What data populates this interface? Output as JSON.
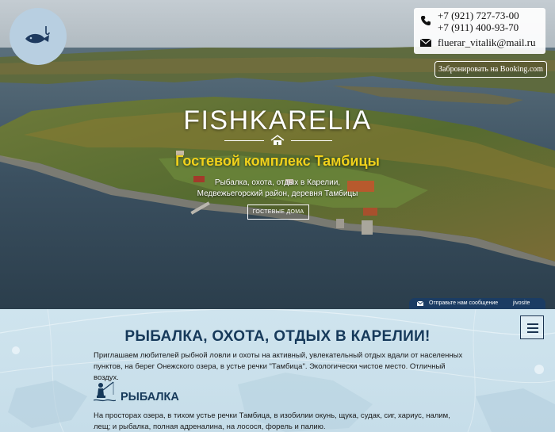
{
  "header": {
    "logo_icon": "fish-hook-icon",
    "phones": [
      "+7 (921) 727-73-00",
      "+7 (911) 400-93-70"
    ],
    "email": "fluerar_vitalik@mail.ru",
    "booking_label": "Забронировать на Booking.com"
  },
  "hero": {
    "brand": "FISHKARELIA",
    "subtitle": "Гостевой комплекс Тамбицы",
    "tagline_line1": "Рыбалка, охота, отдых в Карелии,",
    "tagline_line2": "Медвежьегорский район, деревня Тамбицы",
    "guest_button": "ГОСТЕВЫЕ ДОМА"
  },
  "chat_widget": {
    "label": "Отправьте нам сообщение",
    "brand": "jivosite"
  },
  "main": {
    "heading": "РЫБАЛКА, ОХОТА, ОТДЫХ В КАРЕЛИИ!",
    "intro": "Приглашаем любителей рыбной ловли и охоты на активный, увлекательный отдых вдали от населенных пунктов, на берег Онежского озера, в устье речки \"Тамбица\". Экологически чистое место. Отличный воздух.",
    "section_title": "РЫБАЛКА",
    "section_text": "На просторах озера, в тихом устье речки Тамбица, в изобилии окунь, щука, судак, сиг, хариус, налим, лещ; и рыбалка, полная адреналина, на лосося, форель и палию."
  },
  "colors": {
    "accent_yellow": "#f2d21b",
    "heading_navy": "#16395a",
    "chat_bar": "#1b3c63"
  }
}
